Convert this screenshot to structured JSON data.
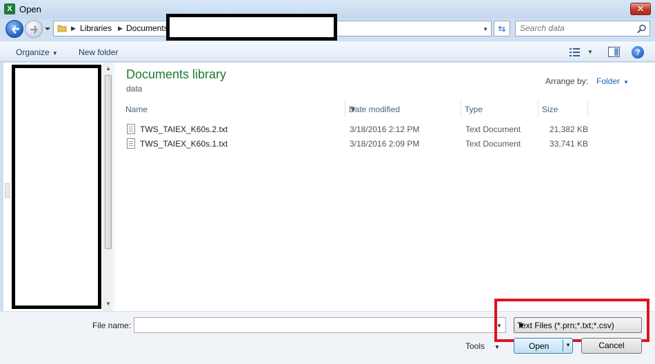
{
  "window": {
    "title": "Open",
    "app_icon": "X"
  },
  "nav": {
    "breadcrumbs": [
      "Libraries",
      "Documents"
    ],
    "search_placeholder": "Search data"
  },
  "toolbar": {
    "organize": "Organize",
    "new_folder": "New folder"
  },
  "library": {
    "title": "Documents library",
    "subtitle": "data",
    "arrange_label": "Arrange by:",
    "arrange_value": "Folder"
  },
  "columns": {
    "name": "Name",
    "date": "Date modified",
    "type": "Type",
    "size": "Size"
  },
  "files": [
    {
      "name": "TWS_TAIEX_K60s.2.txt",
      "date": "3/18/2016 2:12 PM",
      "type": "Text Document",
      "size": "21,382 KB"
    },
    {
      "name": "TWS_TAIEX_K60s.1.txt",
      "date": "3/18/2016 2:09 PM",
      "type": "Text Document",
      "size": "33,741 KB"
    }
  ],
  "bottom": {
    "filename_label": "File name:",
    "filename_value": "",
    "filetype": "Text Files (*.prn;*.txt;*.csv)",
    "tools": "Tools",
    "open": "Open",
    "cancel": "Cancel"
  },
  "colors": {
    "accent": "#1e7a2f",
    "highlight": "#e0121f",
    "link": "#1e64b4"
  }
}
